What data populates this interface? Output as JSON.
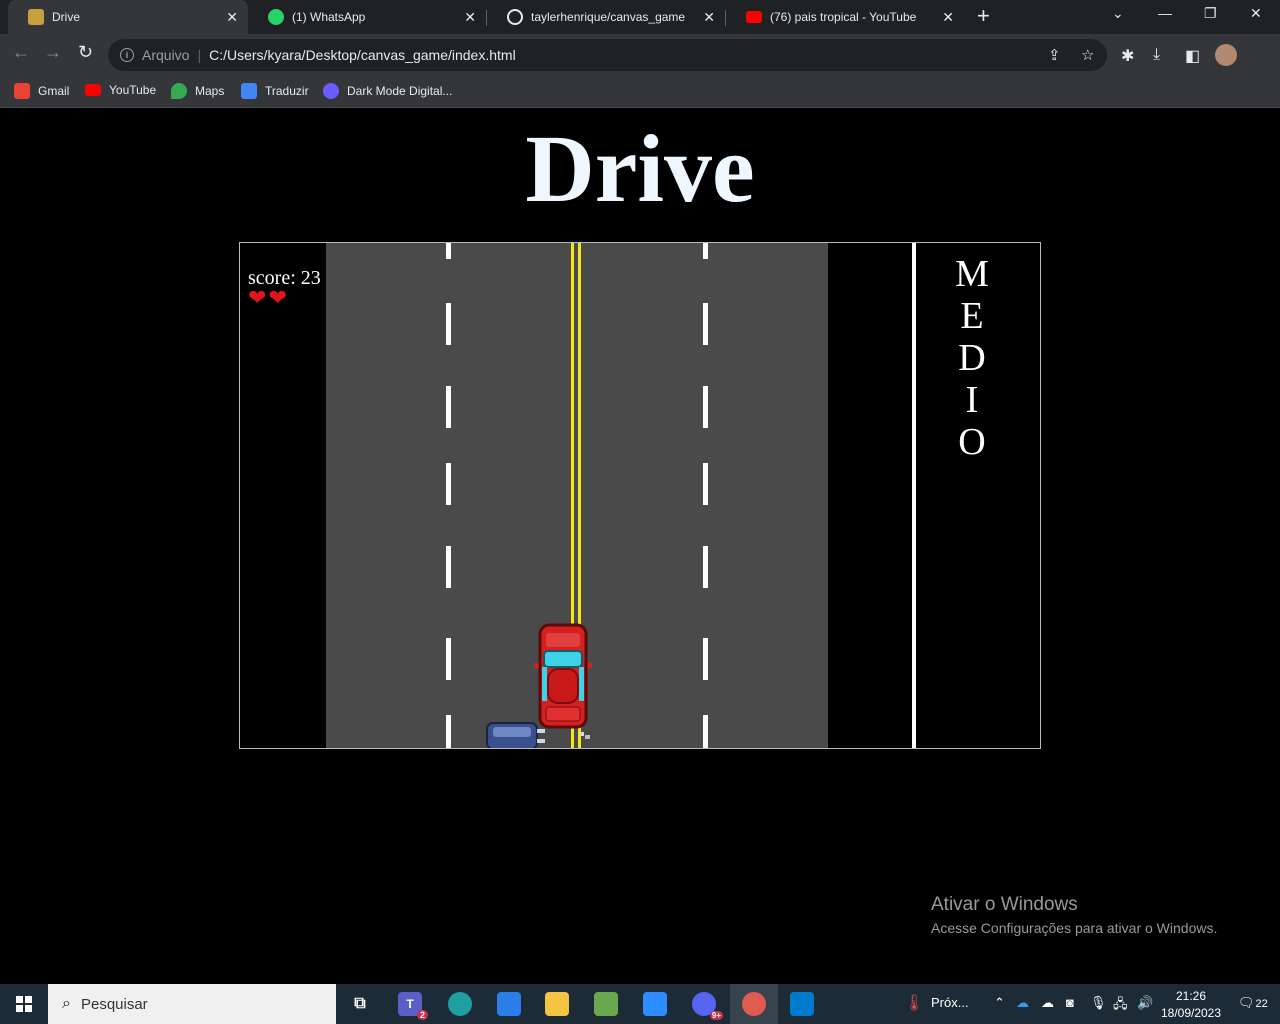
{
  "browser": {
    "tabs": [
      {
        "title": "Drive",
        "favicon_color": "#c8a040",
        "active": true
      },
      {
        "title": "(1) WhatsApp",
        "favicon_color": "#25d366",
        "active": false
      },
      {
        "title": "taylerhenrique/canvas_game",
        "favicon_color": "#ffffff",
        "active": false
      },
      {
        "title": "(76) pais tropical - YouTube",
        "favicon_color": "#ff0000",
        "active": false
      }
    ],
    "omnibox": {
      "scheme_label": "Arquivo",
      "url": "C:/Users/kyara/Desktop/canvas_game/index.html"
    },
    "bookmarks": [
      {
        "label": "Gmail",
        "icon_color": "#ea4335"
      },
      {
        "label": "YouTube",
        "icon_color": "#ff0000"
      },
      {
        "label": "Maps",
        "icon_color": "#34a853"
      },
      {
        "label": "Traduzir",
        "icon_color": "#4285f4"
      },
      {
        "label": "Dark Mode Digital...",
        "icon_color": "#6b5cff"
      }
    ]
  },
  "game": {
    "page_title": "Drive",
    "score_text": "score: 23",
    "lives": 2,
    "difficulty_letters": [
      "M",
      "E",
      "D",
      "I",
      "O"
    ],
    "colors": {
      "road": "#4a4a4a",
      "center_line": "#f3e51b",
      "player_car": "#d42020",
      "enemy_car": "#3a4f8c"
    }
  },
  "watermark": {
    "line1": "Ativar o Windows",
    "line2": "Acesse Configurações para ativar o Windows."
  },
  "taskbar": {
    "search_placeholder": "Pesquisar",
    "weather_label": "Próx...",
    "time": "21:26",
    "date": "18/09/2023",
    "notifications": "22",
    "teams_badge": "2",
    "discord_badge": "9+"
  }
}
